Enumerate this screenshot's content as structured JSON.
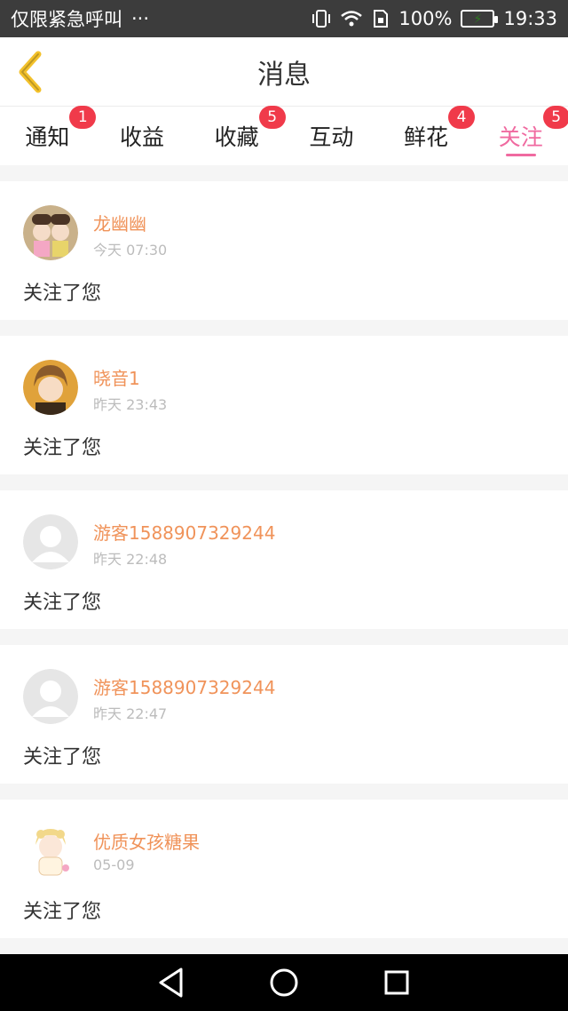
{
  "status_bar": {
    "carrier": "仅限紧急呼叫",
    "dots": "···",
    "battery": "100%",
    "time": "19:33"
  },
  "header": {
    "title": "消息",
    "back_icon": "chevron-left-icon"
  },
  "tabs": [
    {
      "label": "通知",
      "badge": "1"
    },
    {
      "label": "收益",
      "badge": ""
    },
    {
      "label": "收藏",
      "badge": "5"
    },
    {
      "label": "互动",
      "badge": ""
    },
    {
      "label": "鲜花",
      "badge": "4"
    },
    {
      "label": "关注",
      "badge": "5",
      "active": true
    }
  ],
  "messages": [
    {
      "name": "龙幽幽",
      "time": "今天 07:30",
      "text": "关注了您",
      "avatar": "illustrated-avatar"
    },
    {
      "name": "晓音1",
      "time": "昨天 23:43",
      "text": "关注了您",
      "avatar": "illustrated-avatar"
    },
    {
      "name": "游客1588907329244",
      "time": "昨天 22:48",
      "text": "关注了您",
      "avatar": "default-avatar"
    },
    {
      "name": "游客1588907329244",
      "time": "昨天 22:47",
      "text": "关注了您",
      "avatar": "default-avatar"
    },
    {
      "name": "优质女孩糖果",
      "time": "05-09",
      "text": "关注了您",
      "avatar": "illustrated-avatar"
    }
  ],
  "colors": {
    "accent_pink": "#f06aa0",
    "username_orange": "#f0935a",
    "badge_red": "#f03a4a",
    "back_icon_yellow": "#f3c12b"
  }
}
